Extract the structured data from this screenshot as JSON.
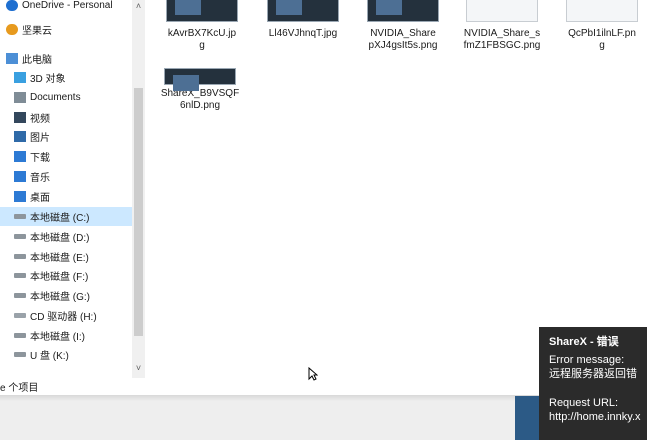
{
  "sidebar": {
    "items": [
      {
        "label": "OneDrive - Personal",
        "icon": "cloud-icon"
      },
      {
        "label": "坚果云",
        "icon": "nutstore-icon"
      },
      {
        "label": "此电脑",
        "icon": "computer-icon"
      },
      {
        "label": "3D 对象",
        "icon": "cube-icon"
      },
      {
        "label": "Documents",
        "icon": "document-icon"
      },
      {
        "label": "视频",
        "icon": "video-icon"
      },
      {
        "label": "图片",
        "icon": "picture-icon"
      },
      {
        "label": "下载",
        "icon": "download-icon"
      },
      {
        "label": "音乐",
        "icon": "music-icon"
      },
      {
        "label": "桌面",
        "icon": "desktop-icon"
      },
      {
        "label": "本地磁盘 (C:)",
        "icon": "drive-icon",
        "selected": true
      },
      {
        "label": "本地磁盘 (D:)",
        "icon": "drive-icon"
      },
      {
        "label": "本地磁盘 (E:)",
        "icon": "drive-icon"
      },
      {
        "label": "本地磁盘 (F:)",
        "icon": "drive-icon"
      },
      {
        "label": "本地磁盘 (G:)",
        "icon": "drive-icon"
      },
      {
        "label": "CD 驱动器 (H:)",
        "icon": "cd-drive-icon"
      },
      {
        "label": "本地磁盘 (I:)",
        "icon": "drive-icon"
      },
      {
        "label": "U 盘 (K:)",
        "icon": "usb-drive-icon"
      }
    ]
  },
  "files": [
    {
      "name_line1": "kAvrBX7KcU.jp",
      "name_line2": "g",
      "thumb": "dark"
    },
    {
      "name_line1": "Ll46VJhnqT.jpg",
      "name_line2": "",
      "thumb": "dark"
    },
    {
      "name_line1": "NVIDIA_Share",
      "name_line2": "pXJ4gsIt5s.png",
      "thumb": "dark"
    },
    {
      "name_line1": "NVIDIA_Share_s",
      "name_line2": "fmZ1FBSGC.png",
      "thumb": "light"
    },
    {
      "name_line1": "QcPbI1ilnLF.pn",
      "name_line2": "g",
      "thumb": "light"
    },
    {
      "name_line1": "ShareX_B9VSQF",
      "name_line2": "6nlD.png",
      "thumb": "dark"
    }
  ],
  "statusbar": {
    "text": "e 个项目"
  },
  "toast": {
    "title": "ShareX - 错误",
    "error_label": "Error message:",
    "error_value": "远程服务器返回错",
    "request_label": "Request URL:",
    "request_value": "http://home.innky.x"
  },
  "scrollbar": {
    "up": "˄",
    "down": "˅"
  }
}
